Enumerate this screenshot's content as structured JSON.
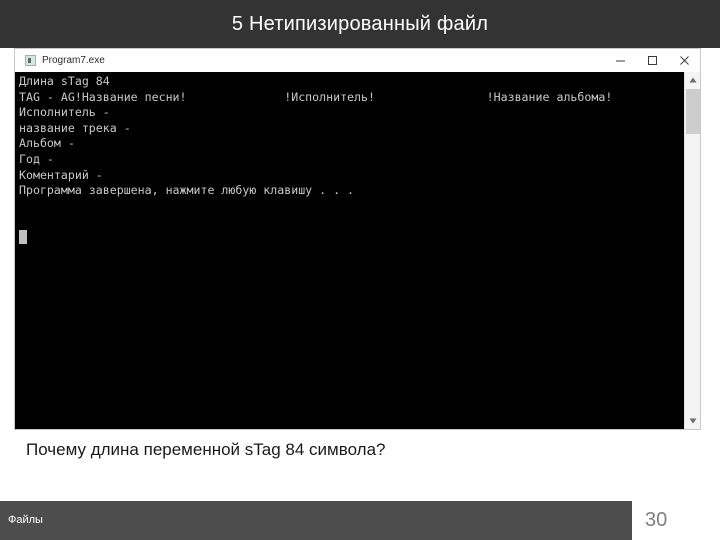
{
  "slide": {
    "title": "5 Нетипизированный файл",
    "header_bg": "#333333",
    "background": "#ffffff"
  },
  "console_window": {
    "titlebar": {
      "icon": "application-icon",
      "title": "Program7.exe",
      "minimize_label": "—",
      "maximize_label": "□",
      "close_label": "×"
    },
    "text_color": "#c8c8c8",
    "background": "#000000",
    "lines": [
      "Длина sTag 84",
      "TAG - AG!Название песни!              !Исполнитель!                !Название альбома!",
      "Исполнитель -",
      "название трека -",
      "Альбом -",
      "Год -",
      "Коментарий -",
      "Программа завершена, нажмите любую клавишу . . ."
    ],
    "scrollbar": {
      "up_arrow": "▲",
      "down_arrow": "▼",
      "thumb_position": "top"
    }
  },
  "caption": {
    "text": "Почему длина переменной sTag 84 символа?"
  },
  "footer": {
    "label": "Файлы",
    "bar_color": "#4d4d4d",
    "page_number": "30",
    "page_number_color": "#808080"
  }
}
